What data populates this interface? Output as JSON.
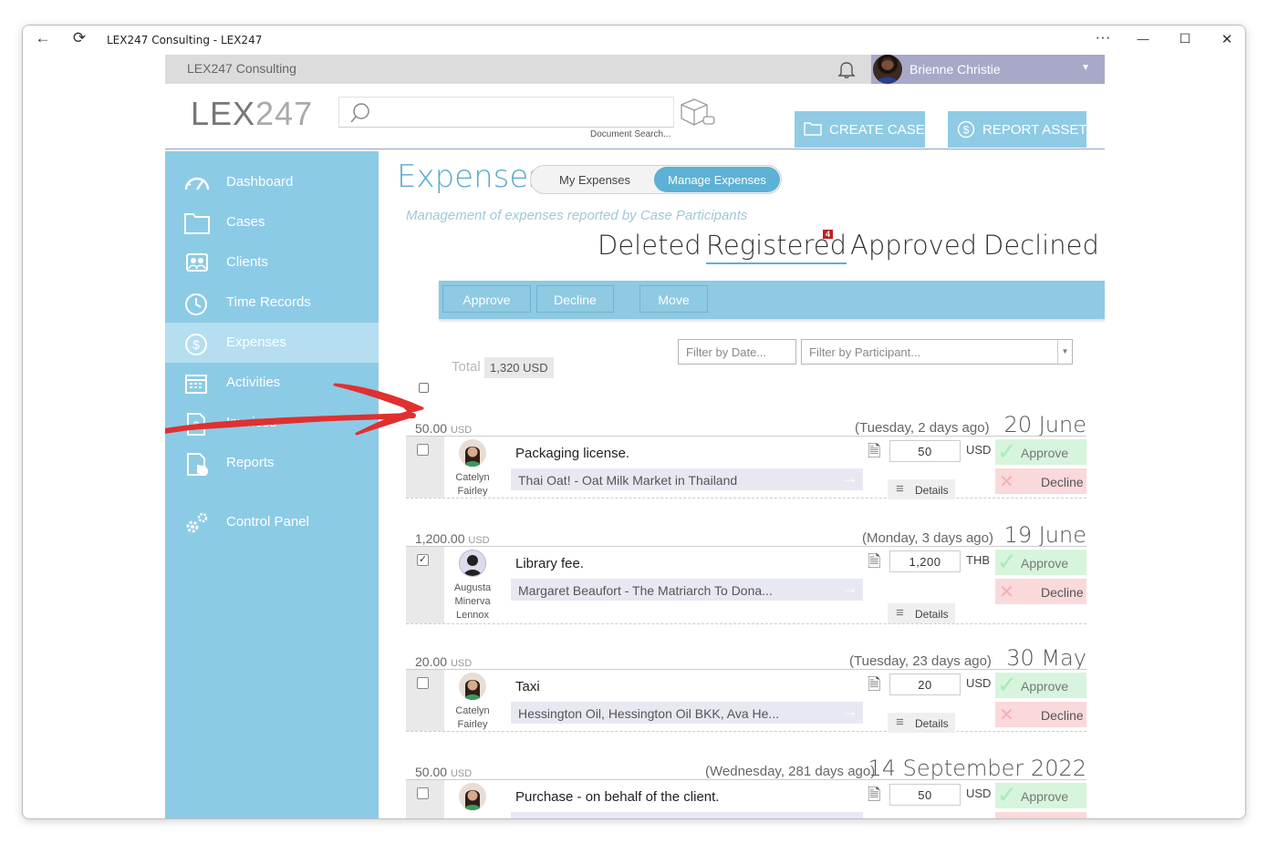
{
  "window": {
    "title": "LEX247 Consulting - LEX247",
    "minimize": "—",
    "maximize": "☐",
    "close": "✕",
    "more": "···"
  },
  "topbar": {
    "org": "LEX247 Consulting",
    "user": "Brienne Christie"
  },
  "header": {
    "logo_main": "LEX",
    "logo_accent": "247",
    "search_label": "Document Search...",
    "create_case": "CREATE CASE",
    "report_asset": "REPORT ASSET"
  },
  "sidebar": {
    "items": [
      {
        "label": "Dashboard",
        "icon": "dashboard-icon"
      },
      {
        "label": "Cases",
        "icon": "folder-icon"
      },
      {
        "label": "Clients",
        "icon": "clients-icon"
      },
      {
        "label": "Time Records",
        "icon": "clock-icon"
      },
      {
        "label": "Expenses",
        "icon": "dollar-icon",
        "active": true
      },
      {
        "label": "Activities",
        "icon": "calendar-icon"
      },
      {
        "label": "Invoices",
        "icon": "invoice-icon"
      },
      {
        "label": "Reports",
        "icon": "report-icon"
      },
      {
        "label": "Control Panel",
        "icon": "gears-icon"
      }
    ]
  },
  "page": {
    "title": "Expenses",
    "seg_my": "My Expenses",
    "seg_manage": "Manage Expenses",
    "subtitle": "Management of expenses reported by Case Participants",
    "tabs": {
      "deleted": "Deleted",
      "registered": "Registered",
      "registered_badge": "4",
      "approved": "Approved",
      "declined": "Declined"
    },
    "toolbar": {
      "approve": "Approve",
      "decline": "Decline",
      "move": "Move"
    },
    "filter_date": "Filter by Date...",
    "filter_participant": "Filter by Participant...",
    "total_label": "Total",
    "total_value": "1,320 USD"
  },
  "expenses": [
    {
      "amount": "50.00",
      "unit": "USD",
      "relative": "(Tuesday, 2 days ago)",
      "date": "20 June",
      "name_lines": [
        "Catelyn",
        "Fairley"
      ],
      "description": "Packaging license.",
      "case": "Thai Oat! - Oat Milk Market in Thailand",
      "value": "50",
      "currency": "USD",
      "checked": false,
      "details": "Details",
      "approve": "Approve",
      "decline": "Decline"
    },
    {
      "amount": "1,200.00",
      "unit": "USD",
      "relative": "(Monday, 3 days ago)",
      "date": "19 June",
      "name_lines": [
        "Augusta",
        "Minerva",
        "Lennox"
      ],
      "description": "Library fee.",
      "case": "Margaret Beaufort - The Matriarch To Dona...",
      "value": "1,200",
      "currency": "THB",
      "checked": true,
      "details": "Details",
      "approve": "Approve",
      "decline": "Decline"
    },
    {
      "amount": "20.00",
      "unit": "USD",
      "relative": "(Tuesday, 23 days ago)",
      "date": "30 May",
      "name_lines": [
        "Catelyn",
        "Fairley"
      ],
      "description": "Taxi",
      "case": "Hessington Oil, Hessington Oil BKK, Ava He...",
      "value": "20",
      "currency": "USD",
      "checked": false,
      "details": "Details",
      "approve": "Approve",
      "decline": "Decline"
    },
    {
      "amount": "50.00",
      "unit": "USD",
      "relative": "(Wednesday, 281 days ago)",
      "date": "14 September 2022",
      "name_lines": [],
      "description": "Purchase - on behalf of the client.",
      "case": "",
      "value": "50",
      "currency": "USD",
      "checked": false,
      "details": "",
      "approve": "Approve",
      "decline": ""
    }
  ],
  "colors": {
    "sidebar": "#8ccbe6",
    "accent": "#5db1d4",
    "approve": "#d6f5dc",
    "decline": "#fad9da",
    "arrow": "#e03030"
  }
}
